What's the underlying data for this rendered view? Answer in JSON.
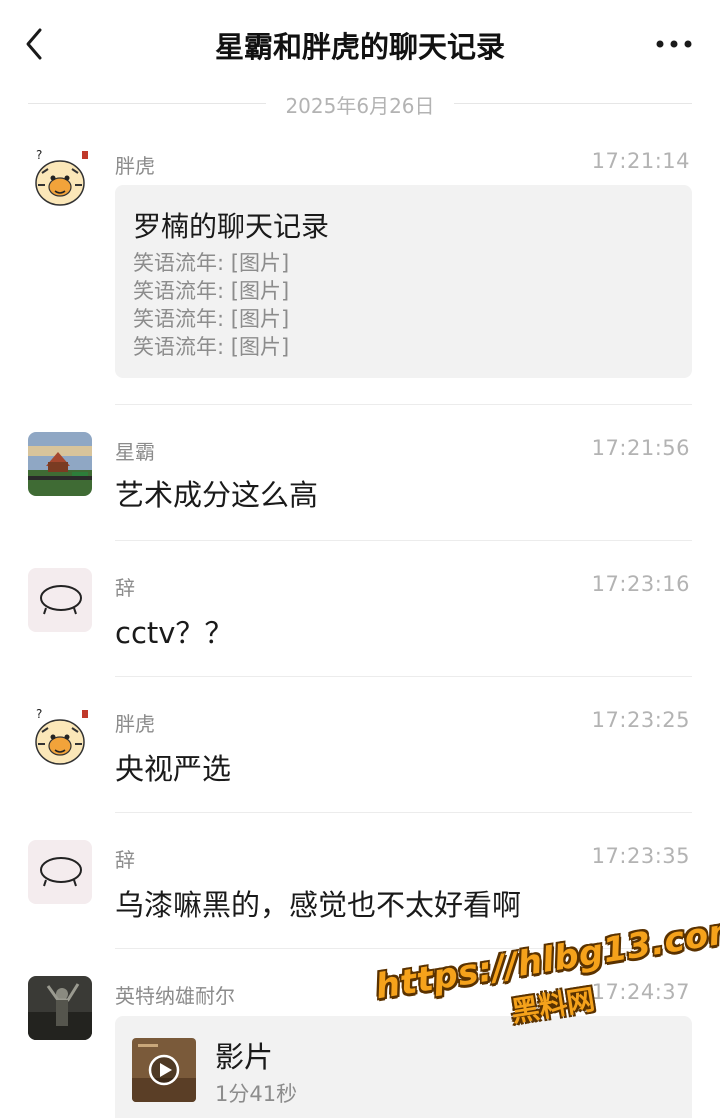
{
  "header": {
    "title": "星霸和胖虎的聊天记录",
    "back_icon": "chevron-left-icon",
    "more_icon": "more-horizontal-icon"
  },
  "date_separator": "2025年6月26日",
  "messages": [
    {
      "sender": "胖虎",
      "time": "17:21:14",
      "type": "chat-record",
      "card": {
        "title": "罗楠的聊天记录",
        "lines": [
          "笑语流年: [图片]",
          "笑语流年: [图片]",
          "笑语流年: [图片]",
          "笑语流年: [图片]"
        ]
      }
    },
    {
      "sender": "星霸",
      "time": "17:21:56",
      "type": "text",
      "text": "艺术成分这么高"
    },
    {
      "sender": "辞",
      "time": "17:23:16",
      "type": "text",
      "text": "cctv？？"
    },
    {
      "sender": "胖虎",
      "time": "17:23:25",
      "type": "text",
      "text": "央视严选"
    },
    {
      "sender": "辞",
      "time": "17:23:35",
      "type": "text",
      "text": "乌漆嘛黑的，感觉也不太好看啊"
    },
    {
      "sender": "英特纳雄耐尔",
      "time": "17:24:37",
      "type": "video",
      "video": {
        "title": "影片",
        "duration": "1分41秒",
        "icon": "play-icon"
      }
    }
  ],
  "watermark": {
    "url": "https://hlbg13.com",
    "name": "黑料网"
  }
}
